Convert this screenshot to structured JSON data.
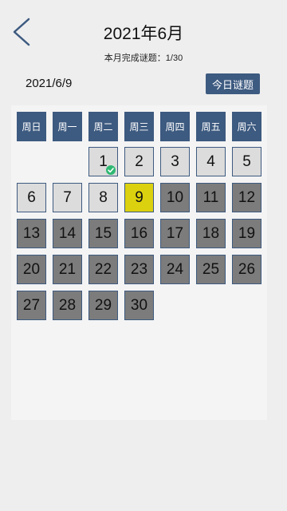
{
  "header": {
    "title": "2021年6月",
    "progress_text": "本月完成谜题：1/30",
    "back_icon": "chevron-left-icon"
  },
  "toolbar": {
    "current_date": "2021/6/9",
    "today_button_label": "今日谜题"
  },
  "colors": {
    "accent": "#3d5a80",
    "today": "#dcd10e",
    "past_day": "#dcdcdc",
    "future_day": "#7c7c7c",
    "completed_check": "#2eb872"
  },
  "calendar": {
    "weekdays": [
      "周日",
      "周一",
      "周二",
      "周三",
      "周四",
      "周五",
      "周六"
    ],
    "first_weekday_index": 2,
    "days": [
      {
        "label": "1",
        "state": "past",
        "completed": true
      },
      {
        "label": "2",
        "state": "past",
        "completed": false
      },
      {
        "label": "3",
        "state": "past",
        "completed": false
      },
      {
        "label": "4",
        "state": "past",
        "completed": false
      },
      {
        "label": "5",
        "state": "past",
        "completed": false
      },
      {
        "label": "6",
        "state": "past",
        "completed": false
      },
      {
        "label": "7",
        "state": "past",
        "completed": false
      },
      {
        "label": "8",
        "state": "past",
        "completed": false
      },
      {
        "label": "9",
        "state": "today",
        "completed": false
      },
      {
        "label": "10",
        "state": "future",
        "completed": false
      },
      {
        "label": "11",
        "state": "future",
        "completed": false
      },
      {
        "label": "12",
        "state": "future",
        "completed": false
      },
      {
        "label": "13",
        "state": "future",
        "completed": false
      },
      {
        "label": "14",
        "state": "future",
        "completed": false
      },
      {
        "label": "15",
        "state": "future",
        "completed": false
      },
      {
        "label": "16",
        "state": "future",
        "completed": false
      },
      {
        "label": "17",
        "state": "future",
        "completed": false
      },
      {
        "label": "18",
        "state": "future",
        "completed": false
      },
      {
        "label": "19",
        "state": "future",
        "completed": false
      },
      {
        "label": "20",
        "state": "future",
        "completed": false
      },
      {
        "label": "21",
        "state": "future",
        "completed": false
      },
      {
        "label": "22",
        "state": "future",
        "completed": false
      },
      {
        "label": "23",
        "state": "future",
        "completed": false
      },
      {
        "label": "24",
        "state": "future",
        "completed": false
      },
      {
        "label": "25",
        "state": "future",
        "completed": false
      },
      {
        "label": "26",
        "state": "future",
        "completed": false
      },
      {
        "label": "27",
        "state": "future",
        "completed": false
      },
      {
        "label": "28",
        "state": "future",
        "completed": false
      },
      {
        "label": "29",
        "state": "future",
        "completed": false
      },
      {
        "label": "30",
        "state": "future",
        "completed": false
      }
    ]
  }
}
